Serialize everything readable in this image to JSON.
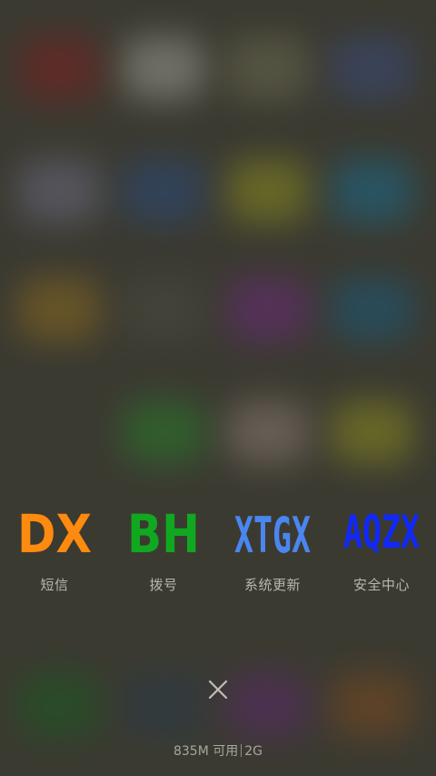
{
  "recent_apps": [
    {
      "icon_text": "DX",
      "label": "短信",
      "color": "#ff8a10"
    },
    {
      "icon_text": "BH",
      "label": "拨号",
      "color": "#10a820"
    },
    {
      "icon_text": "XTGX",
      "label": "系统更新",
      "color": "#4a86f0"
    },
    {
      "icon_text": "AQZX",
      "label": "安全中心",
      "color": "#1028f8"
    }
  ],
  "close_icon": "close-icon",
  "memory": {
    "available": "835M 可用",
    "total": "2G"
  },
  "colors": {
    "background": "#3b3a31",
    "label_text": "#b7b7ae"
  }
}
